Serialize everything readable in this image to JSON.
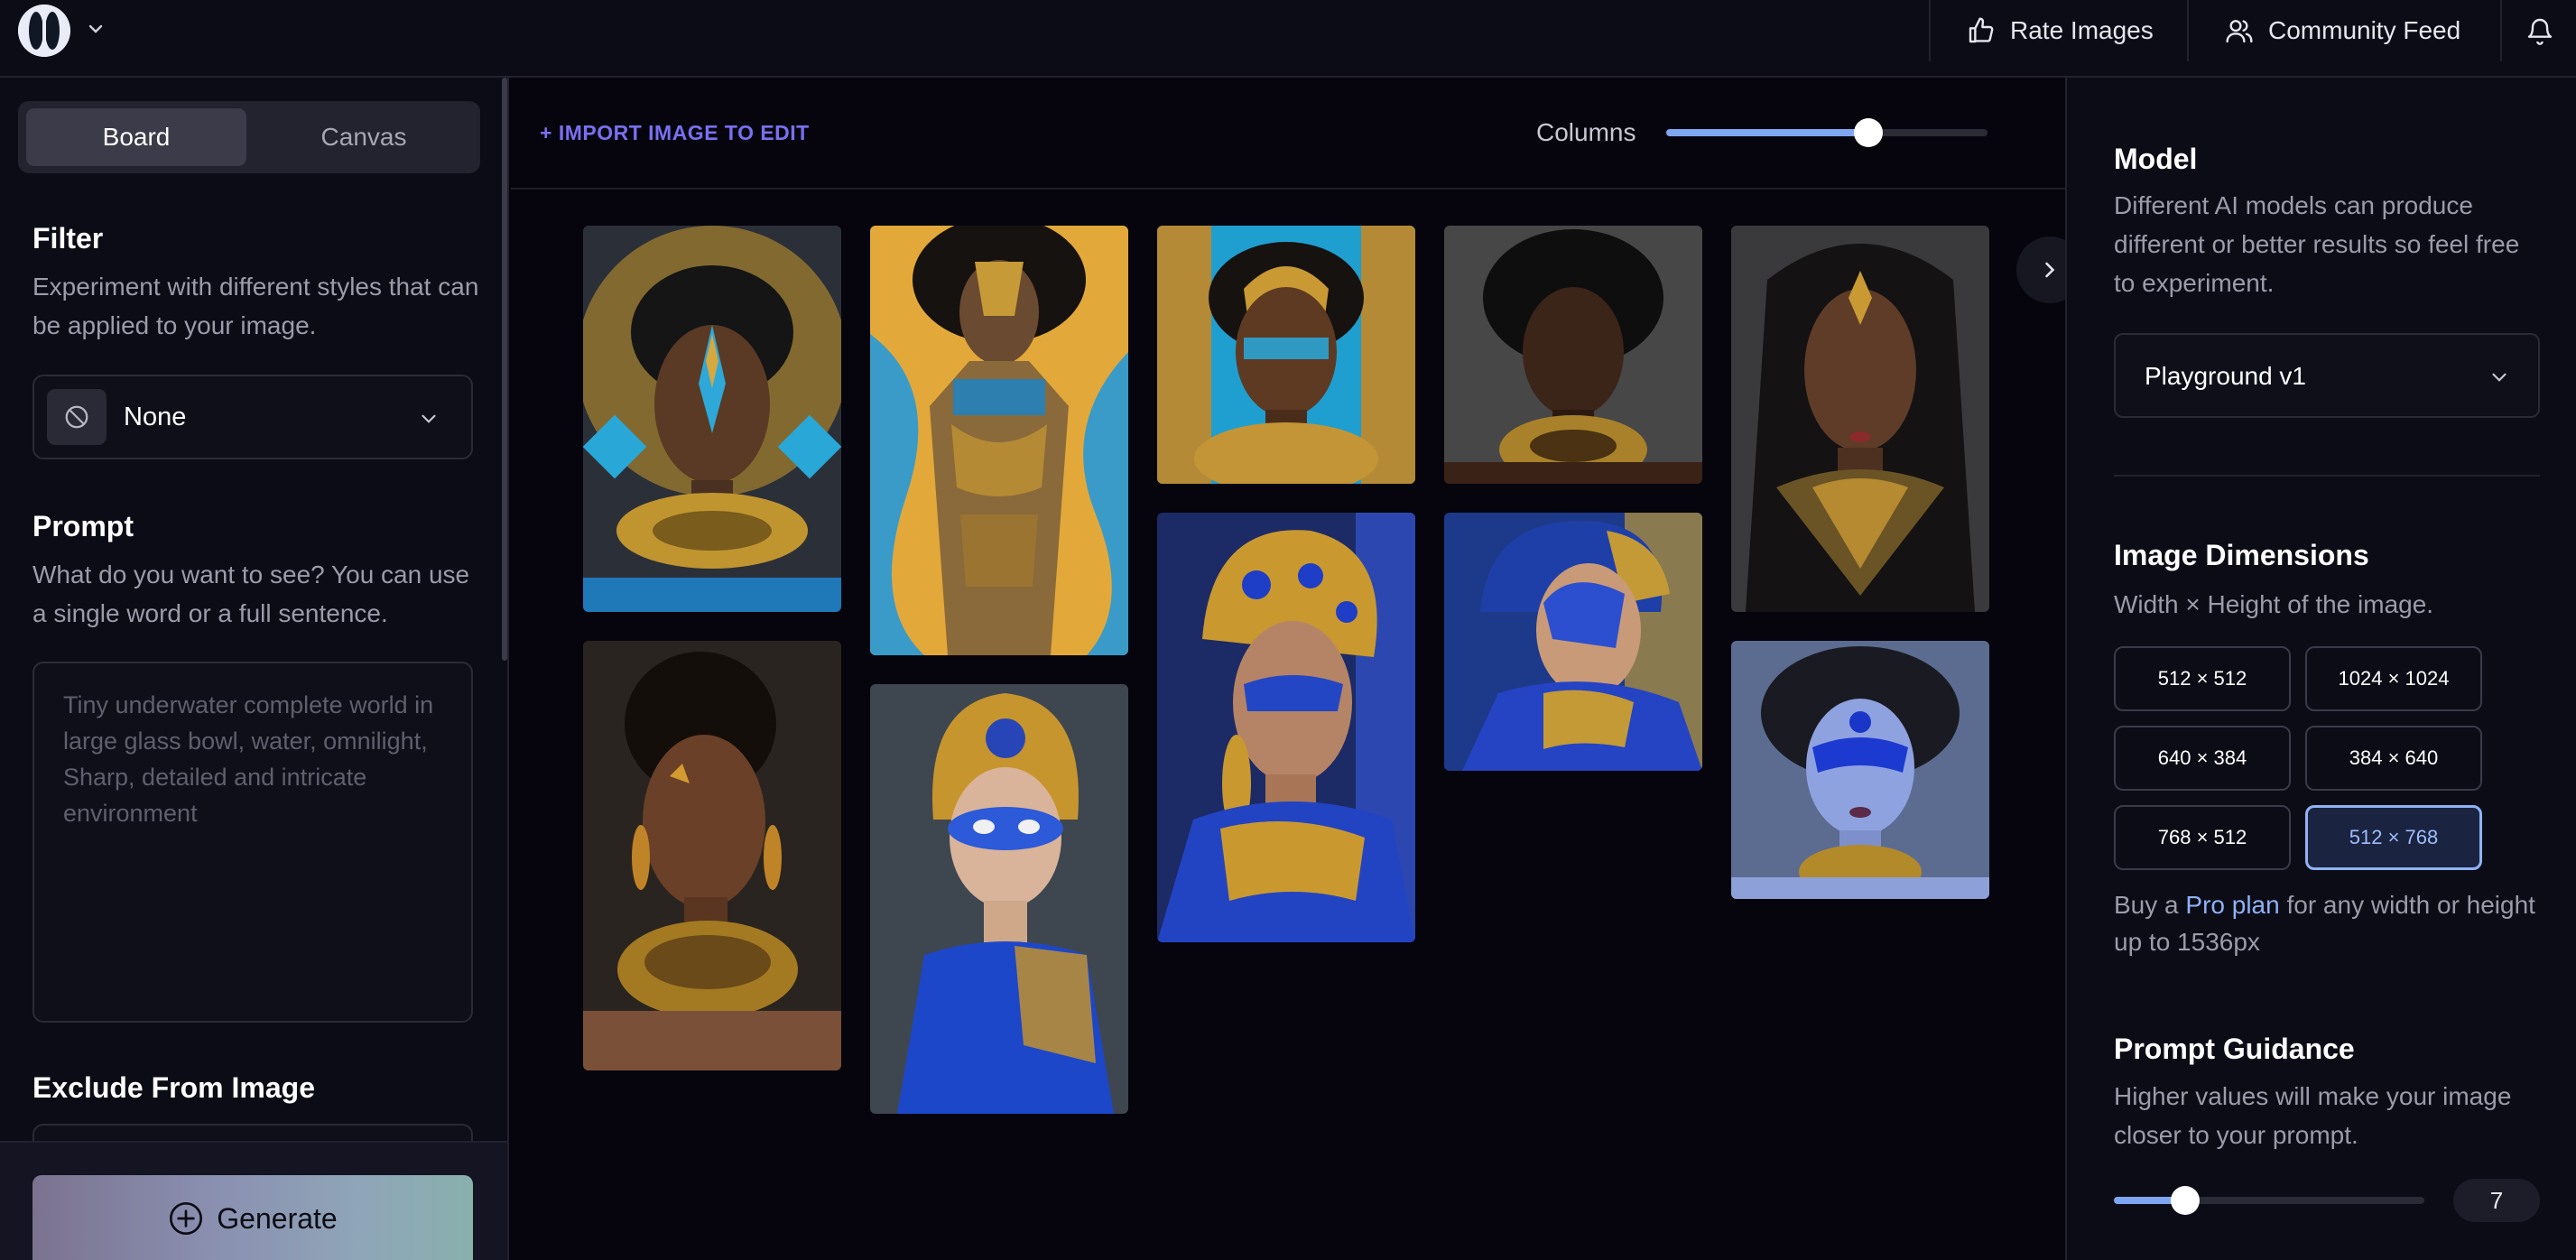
{
  "header": {
    "rate_label": "Rate Images",
    "community_label": "Community Feed"
  },
  "tabs": {
    "board": "Board",
    "canvas": "Canvas",
    "active": "Board"
  },
  "filter": {
    "title": "Filter",
    "desc": "Experiment with different styles that can be applied to your image.",
    "value": "None"
  },
  "prompt": {
    "title": "Prompt",
    "desc": "What do you want to see? You can use a single word or a full sentence.",
    "placeholder": "Tiny underwater complete world in large glass bowl, water, omnilight, Sharp, detailed and intricate environment"
  },
  "exclude": {
    "title": "Exclude From Image"
  },
  "generate_label": "Generate",
  "board": {
    "import_label": "+ IMPORT IMAGE TO EDIT",
    "columns_label": "Columns",
    "columns_level": 0.63
  },
  "gallery": [
    {
      "desc": "Woman with blue and gold face paint, golden headdress and collar necklace"
    },
    {
      "desc": "Woman with afro in gold and blue body paint on yellow-blue background"
    },
    {
      "desc": "Woman with gold headpiece and blue face paint, turquoise and gold backdrop"
    },
    {
      "desc": "Woman with afro wearing a gold necklace on grey background"
    },
    {
      "desc": "Woman with long hair, gold forehead ornament and gold collar"
    },
    {
      "desc": "Woman with gold leaf on cheek, gold earrings and layered gold necklace"
    },
    {
      "desc": "Woman in blue mask with ornate gold headdress and blue dress"
    },
    {
      "desc": "Woman with jeweled gold and sapphire headpiece and blue face paint"
    },
    {
      "desc": "Woman in profile with blue paint and gold jewelry"
    },
    {
      "desc": "Woman with blue face paint, blue skin and gold necklace"
    }
  ],
  "model": {
    "title": "Model",
    "desc": "Different AI models can produce different or better results so feel free to experiment.",
    "value": "Playground v1"
  },
  "dimensions": {
    "title": "Image Dimensions",
    "desc": "Width × Height of the image.",
    "options": [
      "512 × 512",
      "1024 × 1024",
      "640 × 384",
      "384 × 640",
      "768 × 512",
      "512 × 768"
    ],
    "selected": "512 × 768",
    "pro_prefix": "Buy a ",
    "pro_link": "Pro plan",
    "pro_suffix": " for any width or height up to 1536px"
  },
  "guidance": {
    "title": "Prompt Guidance",
    "desc": "Higher values will make your image closer to your prompt.",
    "value": "7",
    "level": 0.23
  },
  "colors": {
    "accent": "#7a6ff0",
    "slider": "#7ea6f2",
    "selected_border": "#8fb2f5"
  }
}
